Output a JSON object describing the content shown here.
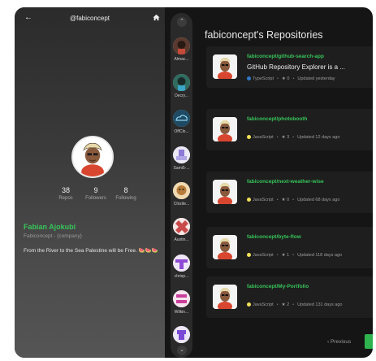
{
  "profile": {
    "handle": "@fabiconcept",
    "name": "Fabian Ajokubi",
    "company": "Fabiconcept - {company}",
    "bio": "From the River to the Sea Palestine will be Free. 🍉🍉🍉",
    "stats": [
      {
        "value": "38",
        "label": "Repos"
      },
      {
        "value": "9",
        "label": "Followers"
      },
      {
        "value": "8",
        "label": "Following"
      }
    ]
  },
  "following": [
    {
      "name": "Almac...",
      "color": "#5a3a2e"
    },
    {
      "name": "Decry...",
      "color": "#2f6b5e"
    },
    {
      "name": "OffClo...",
      "color": "#1e4a63"
    },
    {
      "name": "Sami5-...",
      "color": "#8c7ad6"
    },
    {
      "name": "Chizite...",
      "color": "#b77b3a"
    },
    {
      "name": "Austin...",
      "color": "#c84a4a"
    },
    {
      "name": "chrisp...",
      "color": "#8f4ad6"
    },
    {
      "name": "Wilkin...",
      "color": "#c9409a"
    },
    {
      "name": "...",
      "color": "#7a4ad6"
    }
  ],
  "repos_title": "fabiconcept's Repositories",
  "repos": [
    {
      "name": "fabiconcept/github-search-app",
      "desc": "GitHub Repository Explorer is a ...",
      "lang": "TypeScript",
      "lang_color": "#3178c6",
      "stars": "0",
      "updated": "Updated yesterday"
    },
    {
      "name": "fabiconcept/photobooth",
      "desc": "",
      "lang": "JavaScript",
      "lang_color": "#f1e05a",
      "stars": "3",
      "updated": "Updated 12 days ago"
    },
    {
      "name": "fabiconcept/next-weather-wise",
      "desc": "",
      "lang": "JavaScript",
      "lang_color": "#f1e05a",
      "stars": "0",
      "updated": "Updated 68 days ago"
    },
    {
      "name": "fabiconcept/byte-flow",
      "desc": "",
      "lang": "JavaScript",
      "lang_color": "#f1e05a",
      "stars": "1",
      "updated": "Updated 118 days ago"
    },
    {
      "name": "fabiconcept/My-Portfolio",
      "desc": "",
      "lang": "JavaScript",
      "lang_color": "#f1e05a",
      "stars": "2",
      "updated": "Updated 131 days ago"
    }
  ],
  "pagination": {
    "prev_label": "‹ Previous"
  },
  "colors": {
    "accent": "#37c45a",
    "background": "#151515",
    "card": "#1e1e1e"
  }
}
